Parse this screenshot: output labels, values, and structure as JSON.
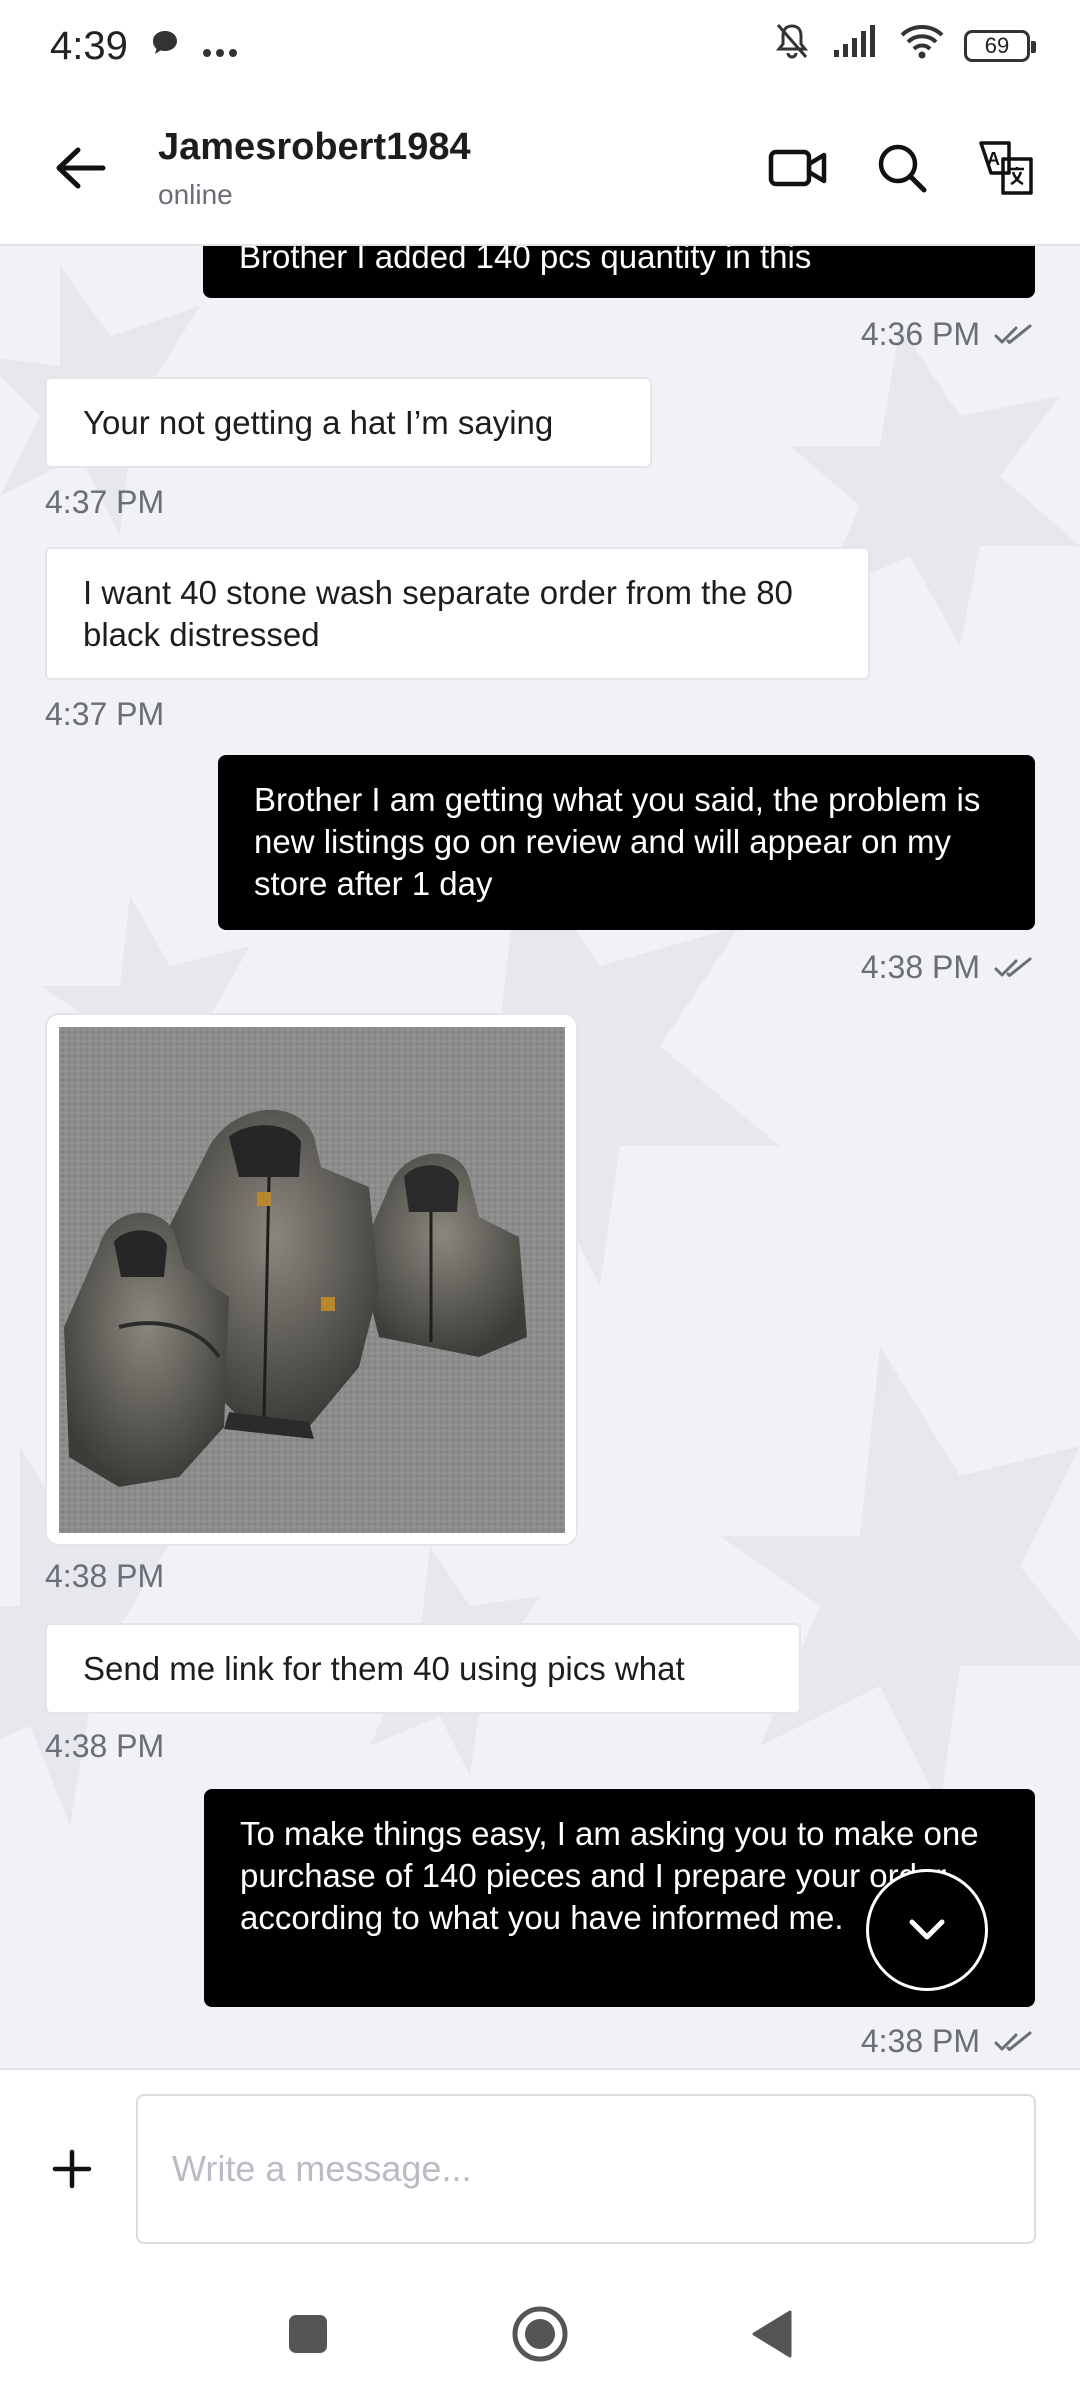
{
  "status_bar": {
    "time": "4:39",
    "battery": "69",
    "icons": [
      "chat-bubble-icon",
      "more-dots-icon",
      "mute-icon",
      "signal-icon",
      "wifi-icon",
      "battery-icon"
    ]
  },
  "header": {
    "contact_name": "Jamesrobert1984",
    "contact_status": "online",
    "actions": [
      "video-call-icon",
      "search-icon",
      "translate-icon"
    ]
  },
  "messages": [
    {
      "direction": "out",
      "text": "Brother I added 140 pcs quantity in this",
      "time": "4:36 PM",
      "read": true
    },
    {
      "direction": "in",
      "text": "Your not getting a hat I’m saying",
      "time": "4:37 PM"
    },
    {
      "direction": "in",
      "text": "I want 40 stone wash separate order from the 80 black distressed",
      "time": "4:37 PM"
    },
    {
      "direction": "out",
      "text": "Brother I am getting what you said, the problem is new listings go on review and will appear on my store after 1 day",
      "time": "4:38 PM",
      "read": true
    },
    {
      "direction": "in",
      "type": "image",
      "image_alt": "photo of stone-washed black hooded jackets on carpet",
      "time": "4:38 PM"
    },
    {
      "direction": "in",
      "text": "Send me link for them 40 using pics what",
      "time": "4:38 PM"
    },
    {
      "direction": "out",
      "text": "To make things easy, I am asking you to make one purchase of 140 pieces and I prepare your order according to what you have informed me.",
      "time": "4:38 PM",
      "read": true
    }
  ],
  "composer": {
    "placeholder": "Write a message..."
  },
  "colors": {
    "outgoing_bubble": "#000000",
    "incoming_bubble": "#ffffff",
    "chat_background": "#f1f2f6",
    "timestamp": "#6b6e78"
  }
}
